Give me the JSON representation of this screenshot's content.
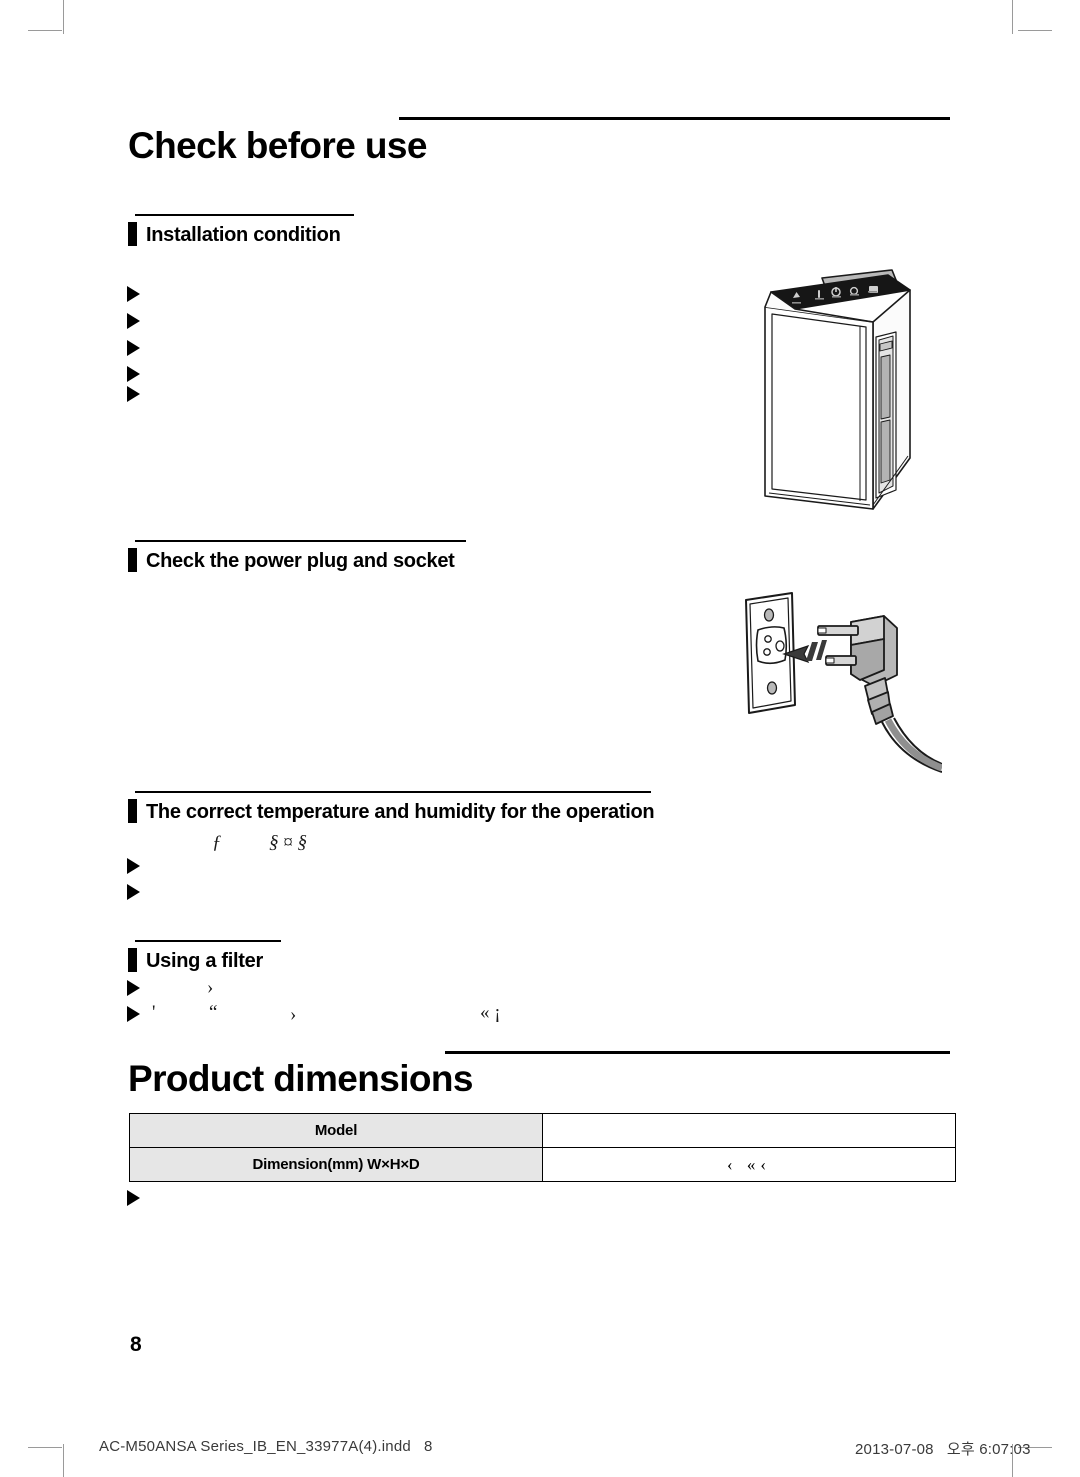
{
  "document": {
    "page_number": "8",
    "footer_left": "AC-M50ANSA Series_IB_EN_33977A(4).indd   8",
    "footer_right": "2013-07-08   오후 6:07:03"
  },
  "sections": {
    "check_before_use": {
      "title": "Check before use",
      "installation": {
        "heading": "Installation condition",
        "bullets": [
          "",
          "",
          "",
          "",
          ""
        ]
      },
      "power_plug": {
        "heading": "Check the power plug and socket"
      },
      "temperature": {
        "heading": "The correct temperature and humidity for the operation",
        "stray_glyph_line": "ƒ          § ¤ §",
        "bullets": [
          "",
          ""
        ]
      },
      "filter": {
        "heading": "Using a filter",
        "bullet_one_glyph": "›",
        "bullet_two_glyph_a": "'",
        "bullet_two_glyph_b": "“",
        "bullet_two_glyph_c": "›",
        "bullet_two_glyph_d": "« ¡"
      }
    },
    "product_dimensions": {
      "title": "Product dimensions",
      "table": {
        "rows": [
          {
            "label": "Model",
            "value": ""
          },
          {
            "label": "Dimension(mm) W×H×D",
            "value": "‹  «‹"
          }
        ]
      },
      "footnote_bullet": ""
    }
  },
  "illustrations": {
    "air_purifier": "air-purifier-illustration",
    "plug_socket": "power-plug-socket-illustration"
  },
  "colors": {
    "rule": "#000000",
    "table_header_bg": "#e6e6e6",
    "crop_mark": "#9a9a9a",
    "panel_dark": "#1c1c1c"
  }
}
